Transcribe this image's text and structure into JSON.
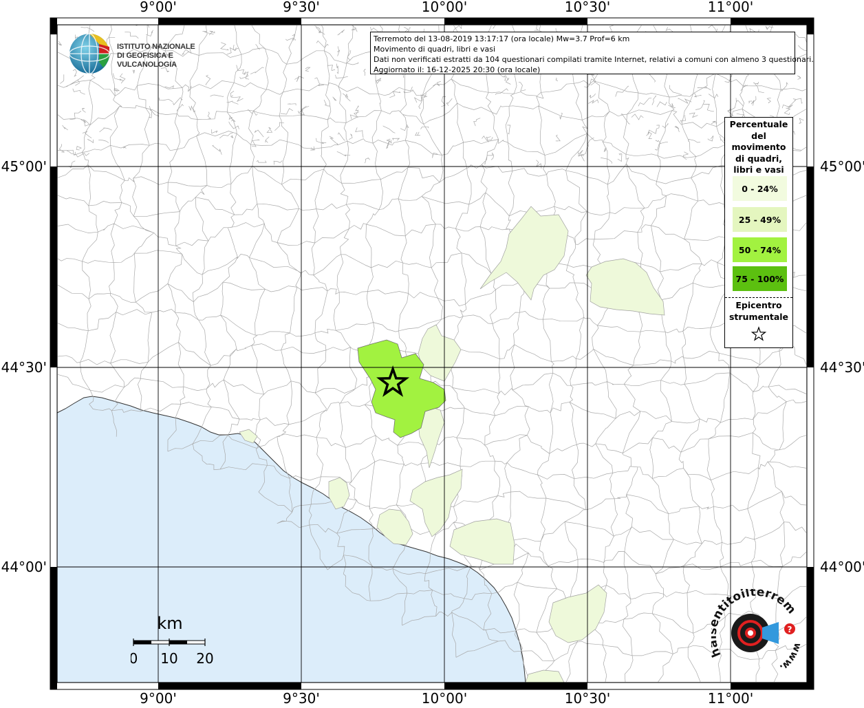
{
  "info": {
    "line1": "Terremoto del 13-08-2019 13:17:17 (ora locale) Mw=3.7 Prof=6 km",
    "line2": "Movimento di quadri, libri e vasi",
    "line3": "Dati non verificati estratti da 104 questionari compilati tramite Internet, relativi a comuni con almeno 3 questionari.",
    "line4": "Aggiornato il: 16-12-2025 20:30 (ora locale)"
  },
  "legend": {
    "title_lines": [
      "Percentuale",
      "del",
      "movimento",
      "di quadri,",
      "libri e vasi"
    ],
    "classes": [
      {
        "label": "0 - 24%",
        "color": "#f2fbdf"
      },
      {
        "label": "25 - 49%",
        "color": "#e4f6bf"
      },
      {
        "label": "50 - 74%",
        "color": "#a2f240"
      },
      {
        "label": "75 - 100%",
        "color": "#5cc010"
      }
    ],
    "epicenter_lines": [
      "Epicentro",
      "strumentale"
    ],
    "epicenter_icon": "star-outline-icon"
  },
  "axes": {
    "top_labels": [
      "9°00'",
      "9°30'",
      "10°00'",
      "10°30'",
      "11°00'"
    ],
    "bottom_labels": [
      "9°00'",
      "9°30'",
      "10°00'",
      "10°30'",
      "11°00'"
    ],
    "left_labels": [
      "45°00'",
      "44°30'",
      "44°00'"
    ],
    "right_labels": [
      "45°00'",
      "44°30'",
      "44°00'"
    ]
  },
  "scale": {
    "unit": "km",
    "ticks": [
      "0",
      "10",
      "20"
    ]
  },
  "logos": {
    "ingv_line1": "ISTITUTO NAZIONALE",
    "ingv_line2": "DI GEOFISICA E VULCANOLOGIA",
    "hsit_text": "haisentitoilterremoto.it",
    "hsit_www": "www."
  },
  "colors": {
    "sea": "#dcedfa",
    "land": "#ffffff",
    "borders": "#a0a0a0",
    "grid": "#000000"
  },
  "epicenter": {
    "lon": 9.82,
    "lat": 44.46
  }
}
